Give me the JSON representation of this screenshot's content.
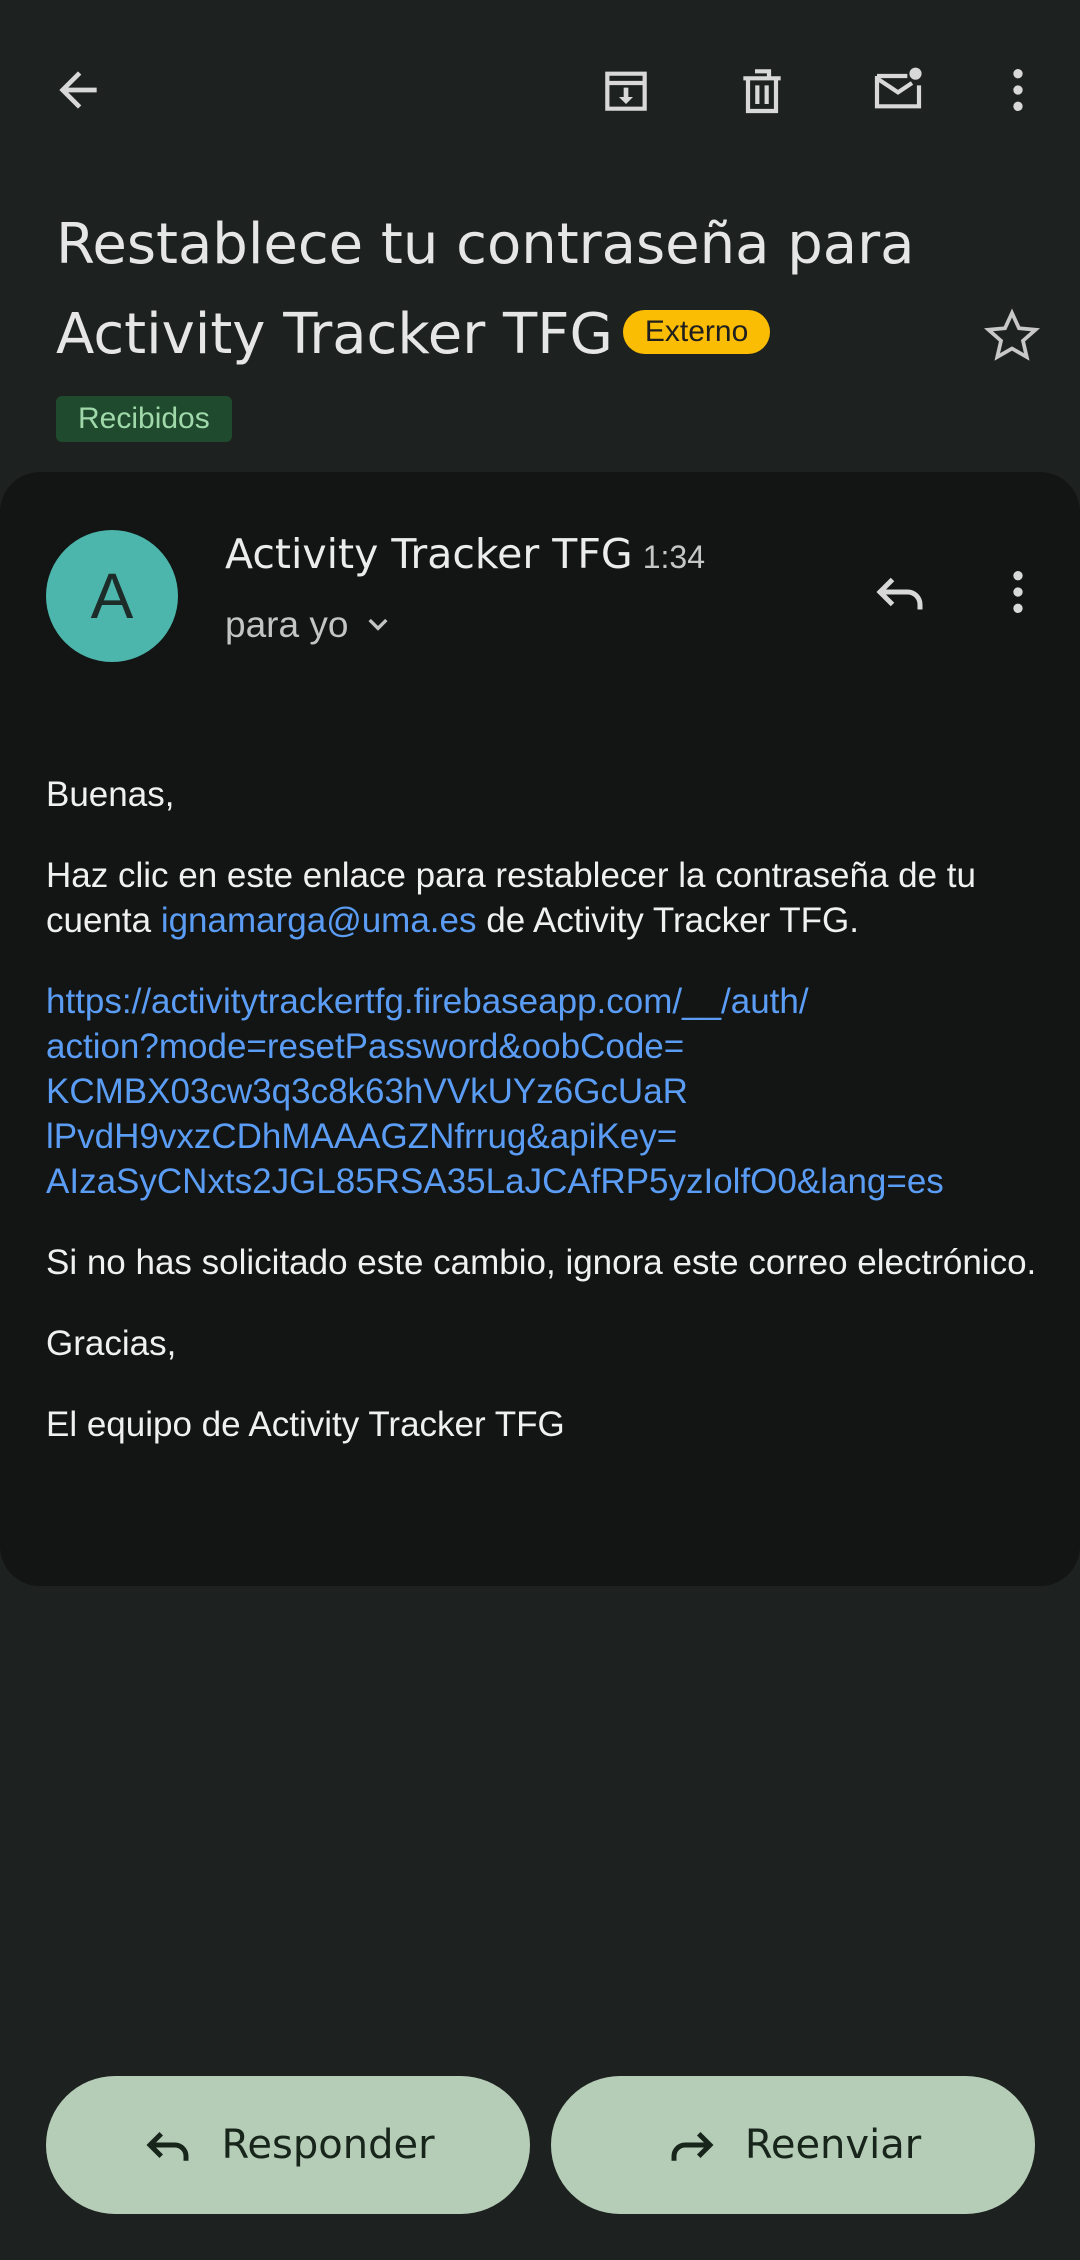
{
  "toolbar": {
    "back_icon": "arrow-back-icon",
    "archive_icon": "archive-icon",
    "delete_icon": "trash-icon",
    "mark_unread_icon": "mail-unread-icon",
    "more_icon": "more-vert-icon"
  },
  "email": {
    "subject_line1": "Restablece tu contraseña para",
    "subject_line2": "Activity Tracker TFG",
    "external_badge": "Externo",
    "label": "Recibidos",
    "sender": "Activity Tracker TFG",
    "time": "1:34",
    "avatar_letter": "A",
    "recipient": "para yo",
    "body": {
      "greeting": "Buenas,",
      "line1_pre": "Haz clic en este enlace para restablecer la contraseña de tu cuenta ",
      "email_link": "ignamarga@uma.es",
      "line1_post": " de Activity Tracker TFG.",
      "url_lines": [
        "https://activitytrackertfg.firebaseapp.com/__/auth/",
        "action?mode=resetPassword&oobCode=",
        "KCMBX03cw3q3c8k63hVVkUYz6GcUaR",
        "lPvdH9vxzCDhMAAAGZNfrrug&apiKey=",
        "AIzaSyCNxts2JGL85RSA35LaJCAfRP5yzIolfO0&lang=es"
      ],
      "ignore_note": "Si no has solicitado este cambio, ignora este correo electrónico.",
      "thanks": "Gracias,",
      "signature": "El equipo de Activity Tracker TFG"
    }
  },
  "actions": {
    "reply_label": "Responder",
    "forward_label": "Reenviar"
  },
  "colors": {
    "background": "#1d211f",
    "card": "#121513",
    "accent_badge": "#fbbc04",
    "avatar": "#4db6ac",
    "link": "#5b9cf5",
    "action_button": "#b5cdb7"
  }
}
